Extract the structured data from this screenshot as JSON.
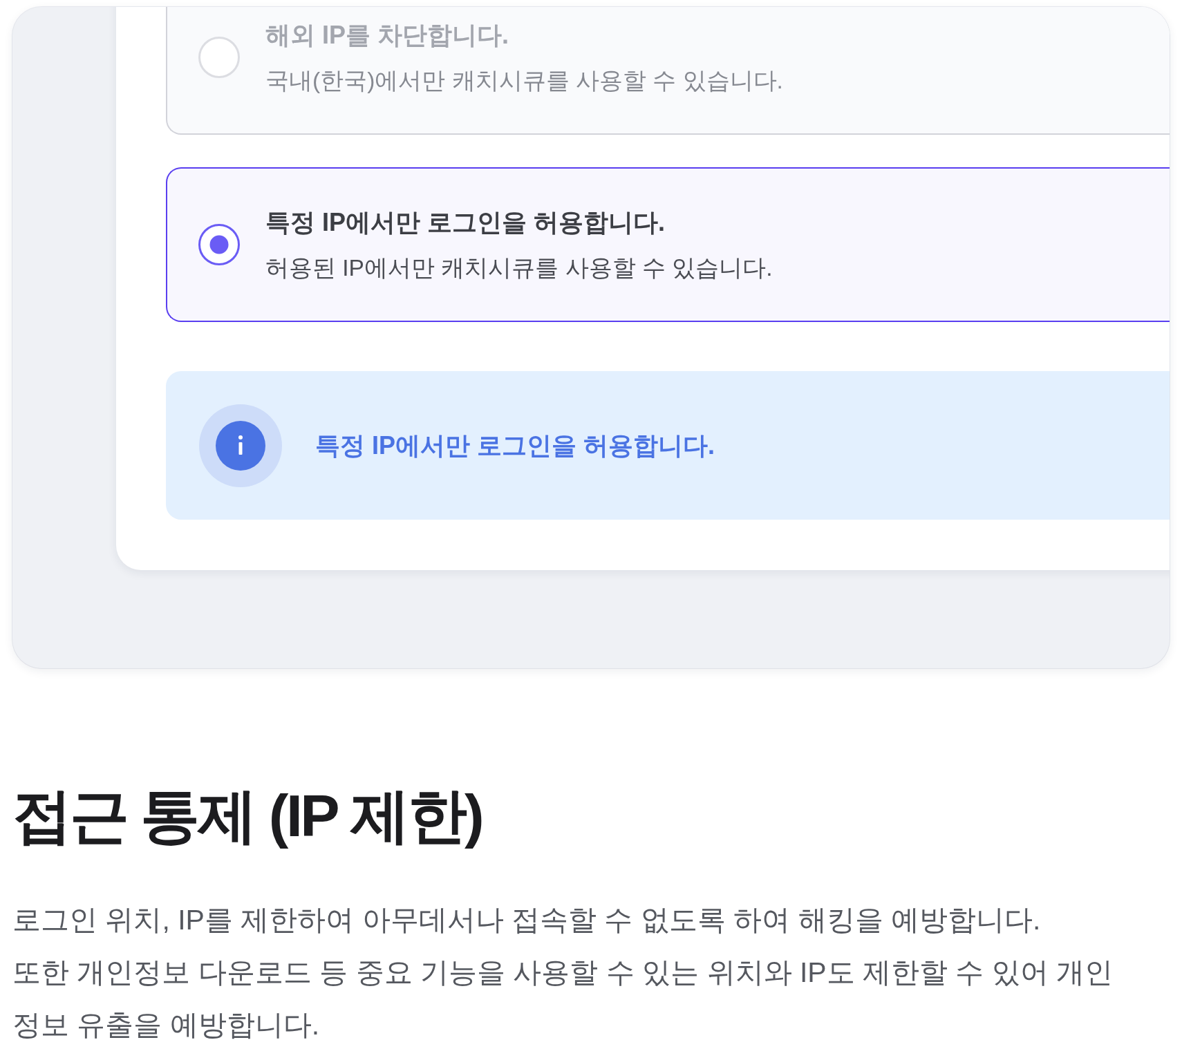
{
  "preview": {
    "options": [
      {
        "title": "해외 IP를 차단합니다.",
        "description": "국내(한국)에서만 캐치시큐를 사용할 수 있습니다.",
        "selected": false
      },
      {
        "title": "특정 IP에서만 로그인을 허용합니다.",
        "description": "허용된 IP에서만 캐치시큐를 사용할 수 있습니다.",
        "selected": true
      }
    ],
    "notice": {
      "text": "특정 IP에서만 로그인을 허용합니다."
    }
  },
  "heading": "접근 통제 (IP 제한)",
  "description": "로그인 위치, IP를 제한하여 아무데서나 접속할 수 없도록 하여 해킹을 예방합니다.\n또한 개인정보 다운로드 등 중요 기능을 사용할 수 있는 위치와 IP도 제한할 수 있어 개인 정보 유출을 예방합니다."
}
